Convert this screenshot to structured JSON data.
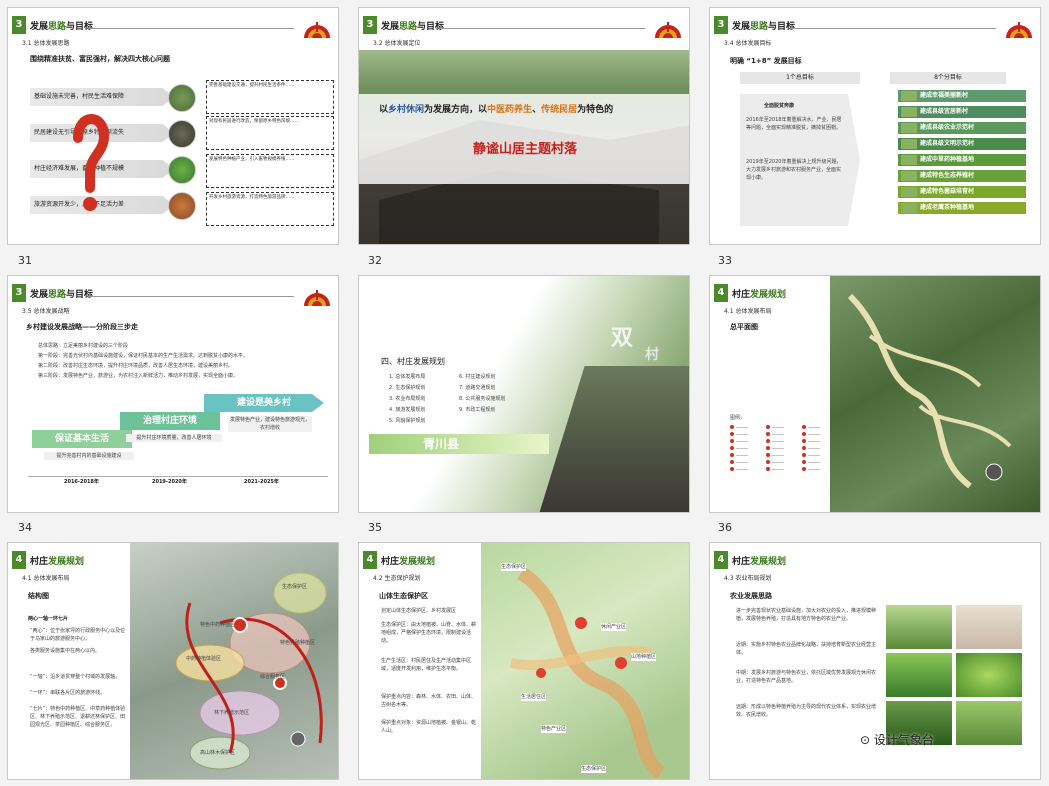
{
  "logo_colors": {
    "red": "#c8211a",
    "gold": "#e0a020"
  },
  "page_numbers": [
    "31",
    "32",
    "33",
    "34",
    "35",
    "36"
  ],
  "slide1": {
    "num": "3",
    "title_a": "发展",
    "title_b": "思路",
    "title_c": "与目标",
    "section": "3.1 总体发展思路",
    "heading": "围绕精准扶贫、富民强村，解决四大核心问题",
    "problems": [
      "基础设施未完善，村民生活难保障",
      "民居建设无引导，原乡特色渐流失",
      "村庄经济难发展，畜牧种植不规模",
      "旅游资源开发少，人气不足活力差"
    ],
    "notes": [
      "完善基础建设交通，提升村民生活条件……",
      "对现有民居进行改造，保留原乡特色风貌……",
      "发展特色种植产业，引入畜牧规模养殖……",
      "开发乡村旅游资源，打造特色旅游品牌……"
    ]
  },
  "slide2": {
    "num": "3",
    "title_a": "发展",
    "title_b": "思路",
    "title_c": "与目标",
    "section": "3.2 总体发展定位",
    "line_prefix": "以",
    "kw1": "乡村休闲",
    "line_mid1": "为发展方向，以",
    "kw2": "中医药养生",
    "line_mid2": "、",
    "kw3": "传统民居",
    "line_suffix": "为特色的",
    "main_title": "静谧山居主题村落"
  },
  "slide3": {
    "num": "3",
    "title_a": "发展",
    "title_b": "思路",
    "title_c": "与目标",
    "section": "3.4 总体发展目标",
    "heading": "明确 “1+8” 发展目标",
    "one_label": "1个总目标",
    "one_title": "全面脱贫奔康",
    "one_text1": "2016年至2018年着重解决水、产业、民居等问题，全面实现精准脱贫，摘掉贫困帽。",
    "one_text2": "2019年至2020年着重解决上规升级问题，大力发展乡村旅游和农村服务产业，全面实现小康。",
    "eight_label": "8个分目标",
    "goals": [
      "建成幸福美丽新村",
      "建成县级宜居新村",
      "建成县级农业示范村",
      "建成县级文明示范村",
      "建成中草药种植基地",
      "建成特色生态养殖村",
      "建成特色菌菇培育村",
      "建成老鹰茶种植基地"
    ]
  },
  "slide4": {
    "num": "3",
    "title_a": "发展",
    "title_b": "思路",
    "title_c": "与目标",
    "section": "3.5 总体发展战略",
    "heading": "乡村建设发展战略——分阶段三步走",
    "lines": [
      "总体思路：立足美丽乡村建设的三个阶段",
      "第一阶段：完善光伏村内基础设施建设，保证村民基本的生产生活需求。达到脱贫小康的水平。",
      "第二阶段：改善村庄生态环境，提升村庄环境品质，改善人居生态环境，建设美丽乡村。",
      "第三阶段：发展特色产业，旅游业，为农村注入新鲜活力，推动乡村发展，实现全面小康。"
    ],
    "steps": [
      "保证基本生活",
      "治理村庄环境",
      "建设是美乡村"
    ],
    "step_notes": [
      "提升完善村内的基础设施建设",
      "提升村庄环境质量，改善人居环境",
      "发展特色产业，建设特色旅游观光，农村增收"
    ],
    "years": [
      "2016-2018年",
      "2019-2020年",
      "2021-2025年"
    ]
  },
  "slide5": {
    "big1": "双",
    "big2": "村",
    "title": "四、村庄发展规划",
    "items_left": [
      "1. 总体发展布局",
      "2. 生态保护规划",
      "3. 农业布局规划",
      "4. 旅游发展规划",
      "5. 风貌保护规划"
    ],
    "items_right": [
      "6. 村庄建设规划",
      "7. 道路交通规划",
      "8. 公共服务设施规划",
      "9. 市政工程规划"
    ],
    "county": "青川县"
  },
  "slide6": {
    "num": "4",
    "title_a": "村庄",
    "title_b": "发展规划",
    "section": "4.1 总体发展布局",
    "heading": "总平面图",
    "legend_title": "图例："
  },
  "slide7": {
    "num": "4",
    "title_a": "村庄",
    "title_b": "发展规划",
    "section": "4.1 总体发展布局",
    "heading": "结构图",
    "subheading": "两心一轴一环七片",
    "para1": "“两心”：位于张家坪的行政服务中心以及位于马家山的旅游服务中心。",
    "para2": "各类服务设施集中在两心以内。",
    "axis": "“一轴”：沿乡道贯穿整个村域的发展轴。",
    "ring": "“一环”：串联各片区的旅游环线。",
    "seven": "“七片”：特色中药种植区、中草药种植体验区、林下养殖示范区、退耕还林保护区、田园观光区、茶园种植区、综合服务区。",
    "map_labels": [
      "生态保护区",
      "中药种植体验区",
      "特色中药种植区",
      "特色养殖种植区",
      "综合服务区",
      "林下养殖示范区",
      "高山林木保护区"
    ]
  },
  "slide8": {
    "num": "4",
    "title_a": "村庄",
    "title_b": "发展规划",
    "section": "4.2 生态保护规划",
    "heading": "山体生态保护区",
    "sub": "划定山体生态保护区、乡村发展区",
    "paras": [
      "生态保护区：由大地植被、山脊、水体、耕地组成，严格保护生态环境，限制建设活动。",
      "生产生活区：村民居住及生产活动集中区域，适度开发利用，维护生态平衡。",
      "保护重点内容：森林、水体、农田、山体、古树名木等。",
      "保护重点对象：资源山地植被、金银山、乾人山。"
    ],
    "map_labels": [
      "生态保护区",
      "休闲产业区",
      "山地种植区",
      "生活居住区",
      "特色产业区",
      "生态保护区"
    ]
  },
  "slide9": {
    "num": "4",
    "title_a": "村庄",
    "title_b": "发展规划",
    "section": "4.3 农业布局规划",
    "heading": "农业发展思路",
    "paras": [
      "进一步完善现状农业基础设施，加大对农业的投入，推进规模种植，发展特色养殖，打造具有地方特色的农业产业。",
      "近期：实施乡村特色农业品牌化战略，扶持培育新型农业经营主体。",
      "中期：发展乡村旅游与特色农业，依托区域优势发展观光休闲农业，打造特色农产品基地。",
      "远期：形成以特色种植养殖为主导的现代农业体系，实现农业增效、农民增收。"
    ],
    "watermark": "设计气象台"
  }
}
